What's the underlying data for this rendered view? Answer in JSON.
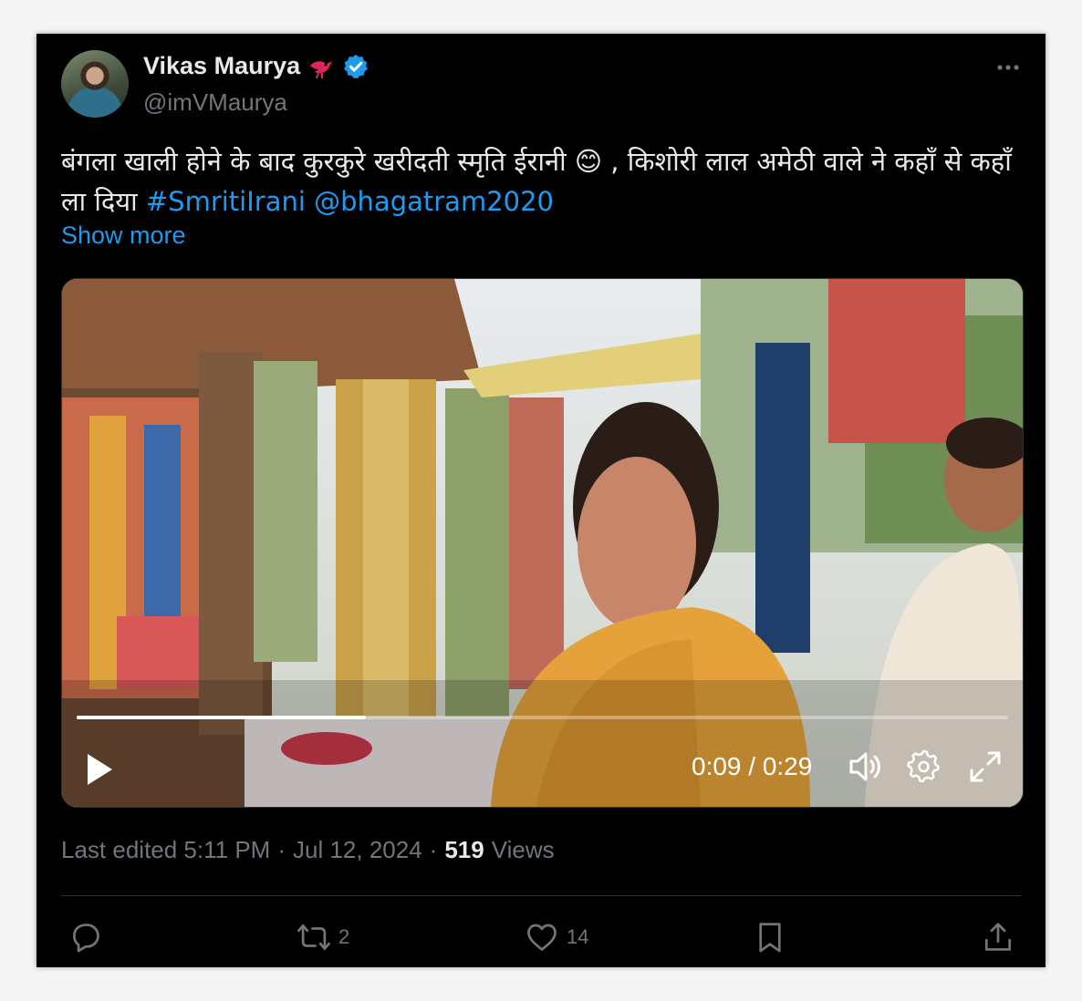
{
  "author": {
    "display_name": "Vikas Maurya",
    "handle": "@imVMaurya",
    "badge_emoji_icon": "red-bird-icon",
    "verified_icon": "verified-badge-icon",
    "verified_color": "#1d9bf0"
  },
  "tweet": {
    "text_part1": "बंगला खाली होने के बाद  कुरकुरे खरीदती स्मृति ईरानी 😊 , किशोरी लाल अमेठी वाले ने कहाँ से कहाँ ला दिया ",
    "hashtag": "#SmritiIrani",
    "mention": "@bhagatram2020",
    "show_more": "Show more"
  },
  "video": {
    "time_display": "0:09 / 0:29",
    "progress_fraction": 0.31
  },
  "meta": {
    "edited_label": "Last edited 5:11 PM",
    "separator": "·",
    "date": "Jul 12, 2024",
    "views_count": "519",
    "views_label": "Views"
  },
  "actions": {
    "reply_count": "",
    "retweet_count": "2",
    "like_count": "14",
    "bookmark_count": "",
    "share_count": ""
  },
  "colors": {
    "background": "#000000",
    "text": "#e7e9ea",
    "secondary": "#71767b",
    "accent": "#1d9bf0"
  }
}
